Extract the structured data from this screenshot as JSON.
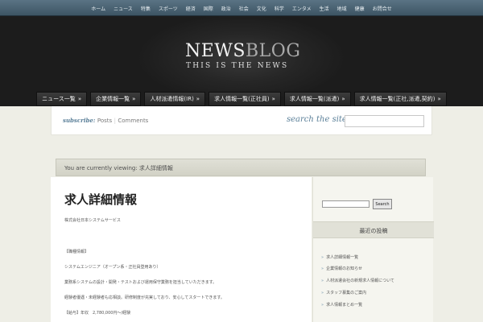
{
  "topnav": [
    "ホーム",
    "ニュース",
    "特集",
    "スポーツ",
    "経済",
    "国際",
    "政治",
    "社会",
    "文化",
    "科学",
    "エンタメ",
    "生活",
    "地域",
    "健康",
    "お問合せ"
  ],
  "logo": {
    "word1": "NEWS",
    "word2": "BLOG",
    "tagline": "THIS IS THE NEWS"
  },
  "mainnav": [
    {
      "label": "ニュース一覧",
      "arrow": "»"
    },
    {
      "label": "企業情報一覧",
      "arrow": "»"
    },
    {
      "label": "人材派遣情報(IR)",
      "arrow": "»"
    },
    {
      "label": "求人情報一覧(正社員)",
      "arrow": "»"
    },
    {
      "label": "求人情報一覧(派遣)",
      "arrow": "»"
    },
    {
      "label": "求人情報一覧(正社,派遣,契約)",
      "arrow": "»"
    }
  ],
  "subbar": {
    "subscribe_label": "subscribe:",
    "posts": "Posts",
    "separator": "|",
    "comments": "Comments",
    "search_label": "search the site"
  },
  "viewbar": {
    "text": "You are currently viewing: 求人詳細情報"
  },
  "post": {
    "title": "求人詳細情報",
    "lines": [
      "株式会社日本システムサービス",
      "【職種情報】",
      "システムエンジニア（オープン系・正社員登用あり）",
      "業務系システムの設計・開発・テストおよび運用保守業務を担当していただきます。",
      "経験者優遇・未経験者も応相談。研修制度が充実しており、安心してスタートできます。",
      "【給与】年収　2,780,000円～/経験"
    ]
  },
  "sidebar": {
    "search_button": "Search",
    "widget_title": "最近の投稿",
    "items": [
      "求人詳細情報一覧",
      "企業情報のお知らせ",
      "人材派遣会社の新規求人情報について",
      "スタッフ募集のご案内",
      "求人情報まとめ一覧"
    ],
    "arrow": "»"
  }
}
